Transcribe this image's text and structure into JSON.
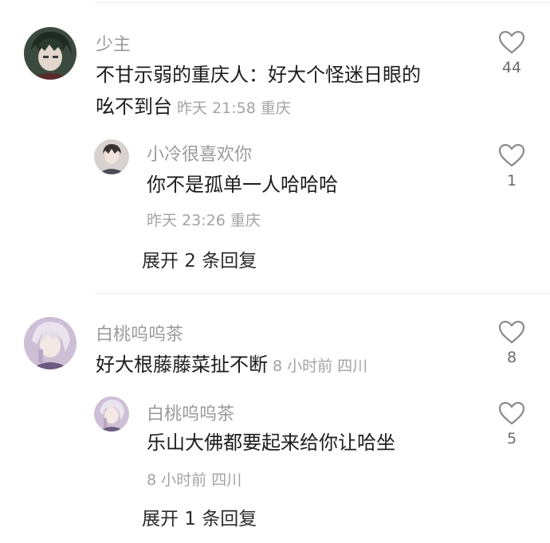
{
  "comments": [
    {
      "author": "少主",
      "text_line1": "不甘示弱的重庆人：好大个怪迷日眼的",
      "text_line2": "吆不到台",
      "time": "昨天 21:58",
      "location": "重庆",
      "likes": "44",
      "reply": {
        "author": "小冷很喜欢你",
        "text": "你不是孤单一人哈哈哈",
        "time": "昨天 23:26",
        "location": "重庆",
        "likes": "1"
      },
      "expand_label": "展开 2 条回复"
    },
    {
      "author": "白桃呜呜茶",
      "text": "好大根藤藤菜扯不断",
      "time": "8 小时前",
      "location": "四川",
      "likes": "8",
      "reply": {
        "author": "白桃呜呜茶",
        "text": "乐山大佛都要起来给你让哈坐",
        "time": "8 小时前",
        "location": "四川",
        "likes": "5"
      },
      "expand_label": "展开 1 条回复"
    }
  ],
  "icons": {
    "like": "heart-outline-icon"
  },
  "colors": {
    "name": "#9a9a9a",
    "meta": "#a3a3a3",
    "text": "#1c1c1c"
  }
}
